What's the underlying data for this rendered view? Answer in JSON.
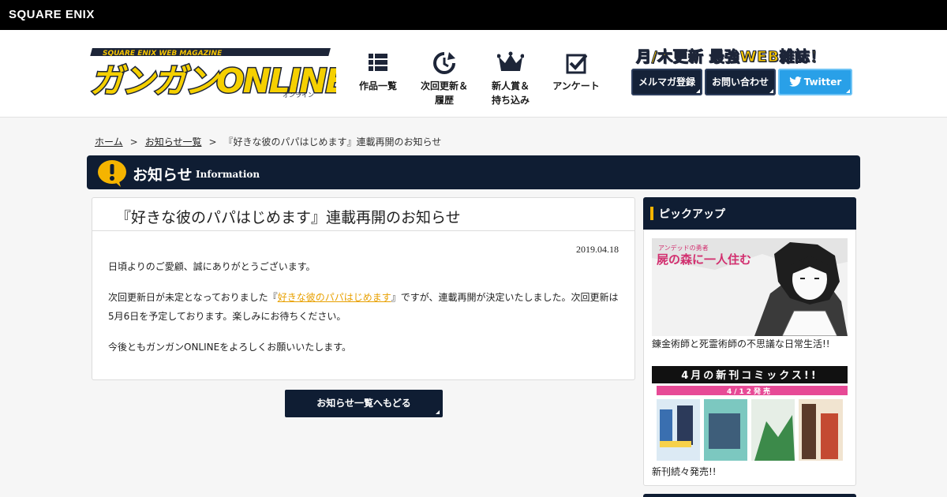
{
  "corp": {
    "logo": "SQUARE ENIX"
  },
  "header": {
    "logo_text": "ガンガンONLINE",
    "logo_sub": "SQUARE ENIX WEB MAGAZINE",
    "logo_kana": "オンライン",
    "nav": [
      {
        "label": "作品一覧",
        "icon": "grid-list-icon"
      },
      {
        "label": "次回更新＆\n履歴",
        "icon": "clock-arrow-icon"
      },
      {
        "label": "新人賞＆\n持ち込み",
        "icon": "crown-icon"
      },
      {
        "label": "アンケート",
        "icon": "checkbox-icon"
      }
    ],
    "tagline": "月/木更新 最強WEB雑誌！",
    "buttons": {
      "mailmag": "メルマガ登録",
      "contact": "お問い合わせ",
      "twitter": "Twitter"
    }
  },
  "breadcrumb": {
    "home": "ホーム",
    "list": "お知らせ一覧",
    "current": "『好きな彼のパパはじめます』連載再開のお知らせ",
    "separator": ">"
  },
  "section": {
    "title": "お知らせ",
    "subtitle": "Information"
  },
  "article": {
    "title": "『好きな彼のパパはじめます』連載再開のお知らせ",
    "date": "2019.04.18",
    "para1": "日頃よりのご愛顧、誠にありがとうございます。",
    "para2_before": "次回更新日が未定となっておりました『",
    "para2_link": "好きな彼のパパはじめます",
    "para2_after": "』ですが、連載再開が決定いたしました。次回更新は5月6日を予定しております。楽しみにお待ちください。",
    "para3": "今後ともガンガンONLINEをよろしくお願いいたします。"
  },
  "back_button": "お知らせ一覧へもどる",
  "sidebar": {
    "title": "ピックアップ",
    "items": [
      {
        "caption": "錬金術師と死霊術師の不思議な日常生活!!",
        "banner_small": "アンデッドの勇者",
        "banner_title": "屍の森に一人住む"
      },
      {
        "caption": "新刊続々発売!!",
        "banner_title": "4月の新刊コミックス!!",
        "banner_date": "4/12発売"
      }
    ]
  },
  "colors": {
    "navy": "#0f1d33",
    "accent": "#f5b400",
    "twitter": "#29a0e8",
    "link": "#e8a000"
  }
}
